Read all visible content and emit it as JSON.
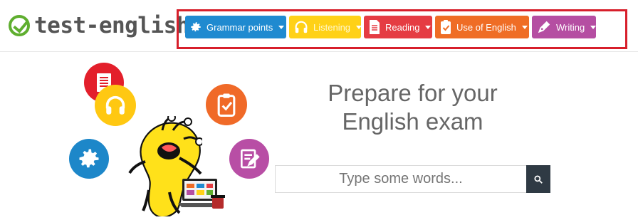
{
  "brand": {
    "name": "test-english"
  },
  "nav": [
    {
      "label": "Grammar points",
      "color": "#1f8ad0",
      "icon": "gear-icon"
    },
    {
      "label": "Listening",
      "color": "#ffd117",
      "icon": "headphones-icon"
    },
    {
      "label": "Reading",
      "color": "#e53c43",
      "icon": "document-icon"
    },
    {
      "label": "Use of English",
      "color": "#ef6d25",
      "icon": "clipboard-icon"
    },
    {
      "label": "Writing",
      "color": "#b54ea2",
      "icon": "pen-icon"
    }
  ],
  "hero": {
    "title": "Prepare for your English exam",
    "search_placeholder": "Type some words..."
  }
}
